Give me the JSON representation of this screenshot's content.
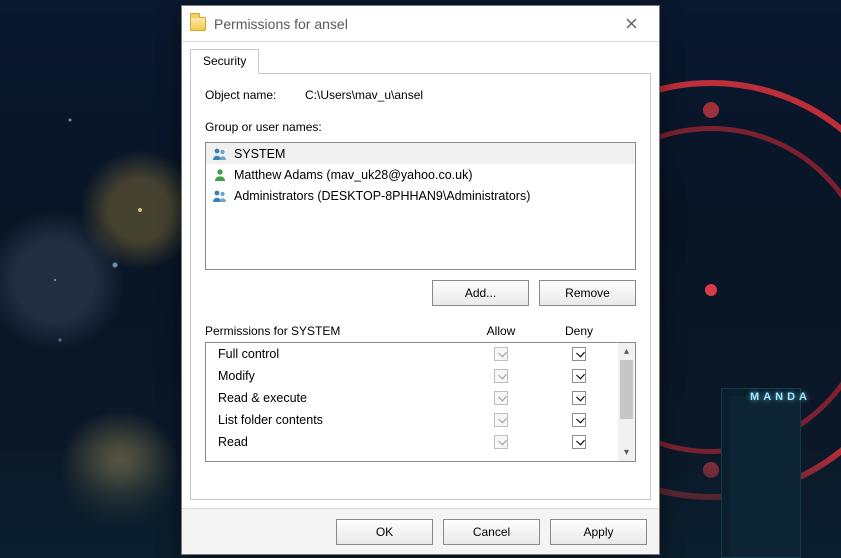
{
  "window": {
    "title": "Permissions for ansel"
  },
  "tab": {
    "security": "Security"
  },
  "object": {
    "label": "Object name:",
    "path": "C:\\Users\\mav_u\\ansel"
  },
  "groups": {
    "label": "Group or user names:",
    "items": [
      {
        "name": "SYSTEM",
        "type": "group",
        "selected": true
      },
      {
        "name": "Matthew Adams (mav_uk28@yahoo.co.uk)",
        "type": "user",
        "selected": false
      },
      {
        "name": "Administrators (DESKTOP-8PHHAN9\\Administrators)",
        "type": "group",
        "selected": false
      }
    ]
  },
  "buttons": {
    "add": "Add...",
    "remove": "Remove",
    "ok": "OK",
    "cancel": "Cancel",
    "apply": "Apply"
  },
  "permissions": {
    "header_label": "Permissions for SYSTEM",
    "col_allow": "Allow",
    "col_deny": "Deny",
    "rows": [
      {
        "label": "Full control",
        "allow_checked": true,
        "allow_enabled": false,
        "deny_checked": true,
        "deny_enabled": true
      },
      {
        "label": "Modify",
        "allow_checked": true,
        "allow_enabled": false,
        "deny_checked": true,
        "deny_enabled": true
      },
      {
        "label": "Read & execute",
        "allow_checked": true,
        "allow_enabled": false,
        "deny_checked": true,
        "deny_enabled": true
      },
      {
        "label": "List folder contents",
        "allow_checked": true,
        "allow_enabled": false,
        "deny_checked": true,
        "deny_enabled": true
      },
      {
        "label": "Read",
        "allow_checked": true,
        "allow_enabled": false,
        "deny_checked": true,
        "deny_enabled": true
      }
    ]
  },
  "bg": {
    "sign": "MANDA"
  }
}
